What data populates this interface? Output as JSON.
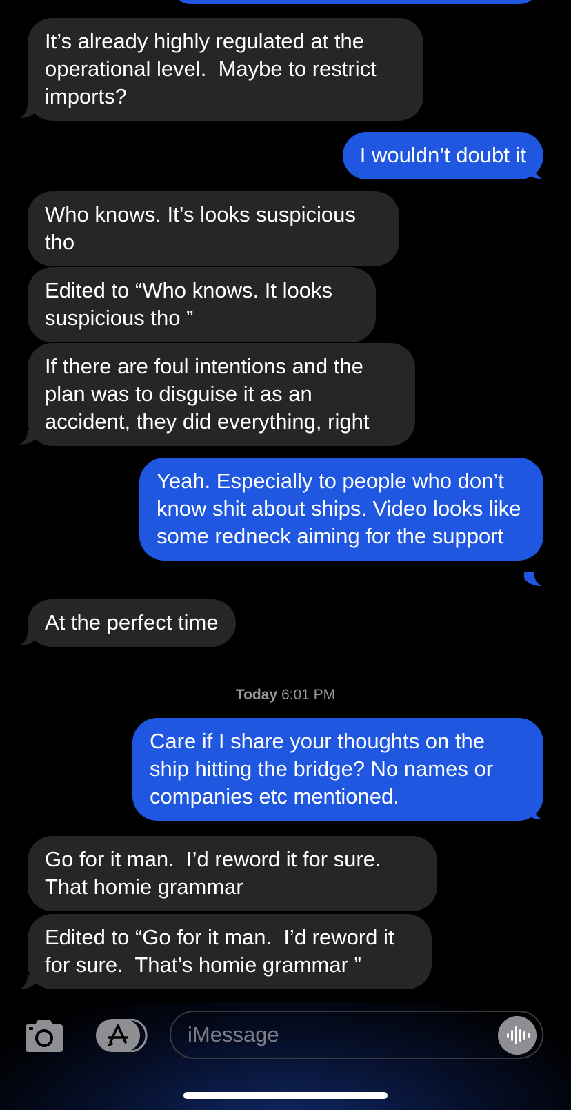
{
  "messages": [
    {
      "from": "them",
      "text": "It’s already highly regulated at the operational level.  Maybe to restrict imports?"
    },
    {
      "from": "me",
      "text": "I wouldn’t doubt it"
    },
    {
      "from": "them",
      "text": "Who knows. It’s looks suspicious tho"
    },
    {
      "from": "them",
      "text": "Edited to “Who knows. It looks suspicious tho ”"
    },
    {
      "from": "them",
      "text": "If there are foul intentions and the plan was to disguise it as an accident, they did everything, right"
    },
    {
      "from": "me",
      "text": "Yeah. Especially to people who don’t know shit about ships. Video looks like some redneck aiming for the support"
    },
    {
      "from": "them",
      "text": "At the perfect time"
    },
    {
      "from": "me",
      "text": "Care if I share your thoughts on the ship hitting the bridge? No names or companies etc mentioned."
    },
    {
      "from": "them",
      "text": "Go for it man.  I’d reword it for sure.  That homie grammar"
    },
    {
      "from": "them",
      "text": "Edited to “Go for it man.  I’d reword it for sure.  That’s homie grammar ”"
    }
  ],
  "timestamp": {
    "day": "Today",
    "time": "6:01 PM"
  },
  "composer": {
    "placeholder": "iMessage",
    "value": "",
    "icons": [
      "camera-icon",
      "app-store-icon",
      "voice-waveform-icon"
    ]
  },
  "colors": {
    "sent_bubble": "#1f57e0",
    "received_bubble": "#262628",
    "background": "#000000"
  }
}
